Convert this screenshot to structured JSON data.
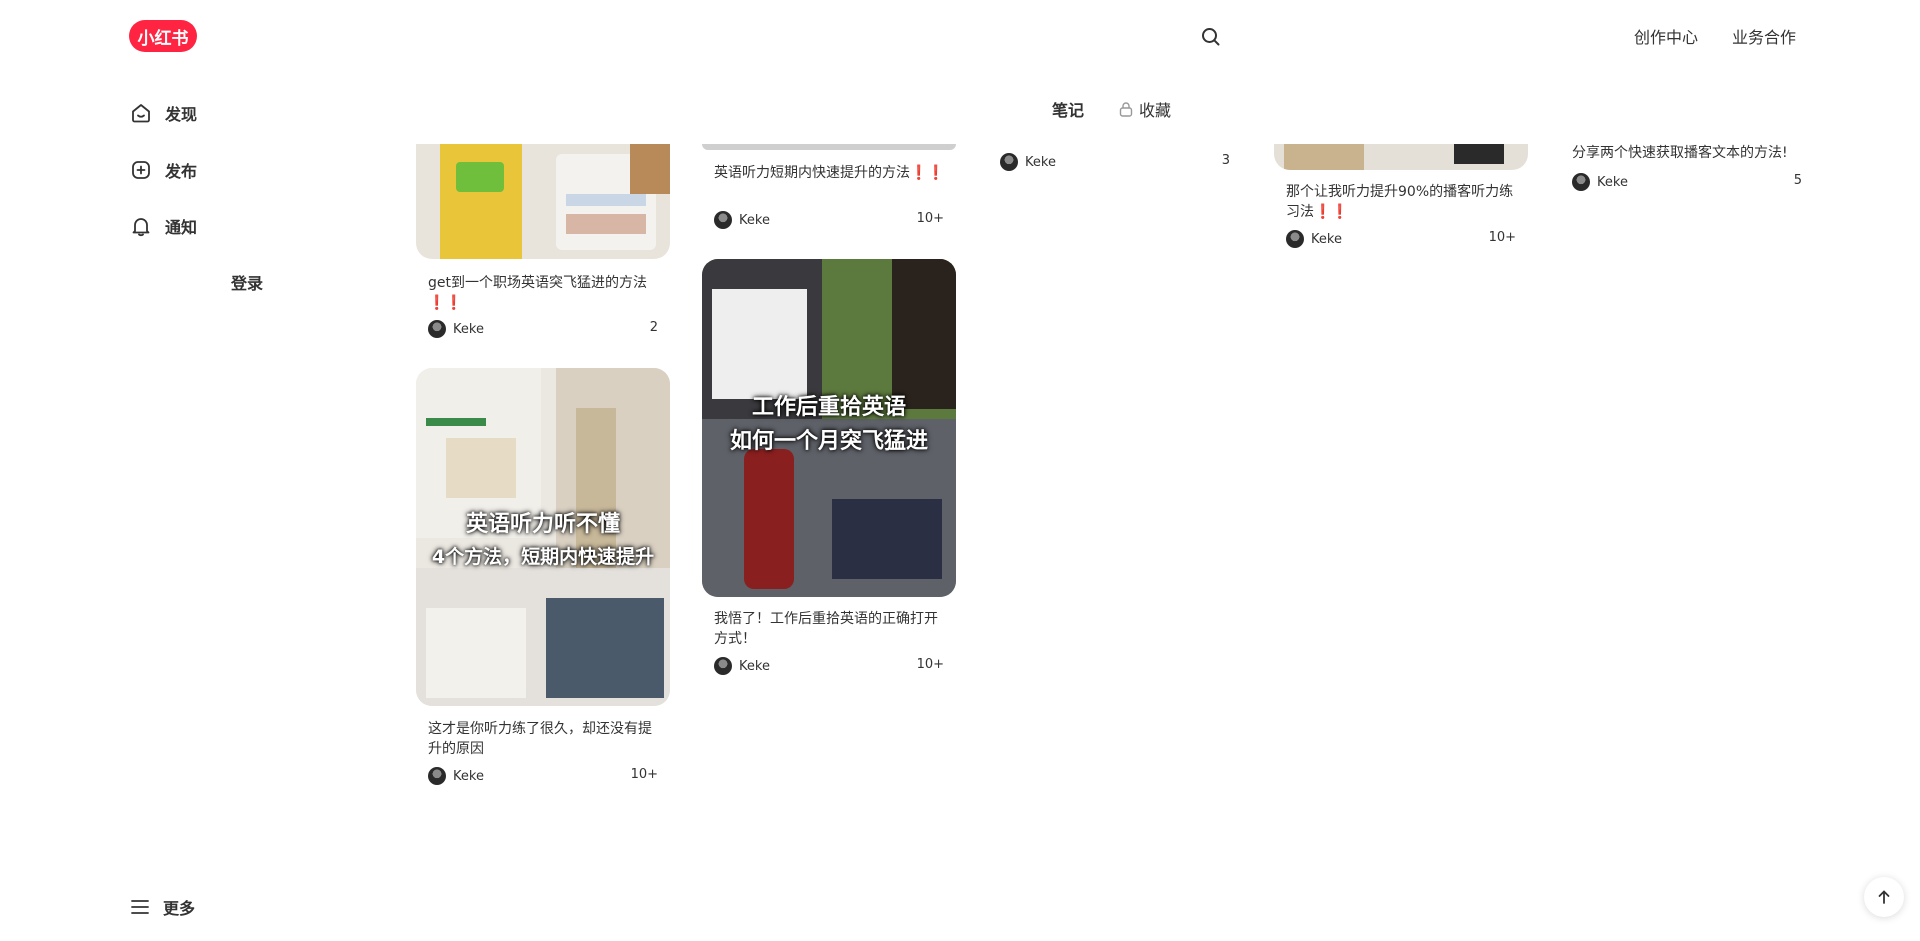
{
  "header": {
    "logo_text": "小红书",
    "links": [
      "创作中心",
      "业务合作"
    ]
  },
  "sidebar": {
    "items": [
      {
        "label": "发现",
        "icon": "home-icon"
      },
      {
        "label": "发布",
        "icon": "plus-icon"
      },
      {
        "label": "通知",
        "icon": "bell-icon"
      }
    ],
    "login": "登录",
    "more": "更多"
  },
  "tabs": {
    "notes": "笔记",
    "collect": "收藏"
  },
  "colors": {
    "brand": "#ff2442",
    "exclaim": "#e02020"
  },
  "notes": [
    {
      "title": "get到一个职场英语突飞猛进的方法",
      "suffix": "❗️❗️",
      "author": "Keke",
      "likes": "2"
    },
    {
      "title": "这才是你听力练了很久，却还没有提升的原因",
      "author": "Keke",
      "likes": "10+",
      "overlay": [
        "英语听力听不懂",
        "4个方法，短期内快速提升"
      ]
    },
    {
      "title": "英语听力短期内快速提升的方法",
      "suffix": "❗️❗️",
      "author": "Keke",
      "likes": "10+"
    },
    {
      "title": "我悟了！工作后重拾英语的正确打开方式！",
      "author": "Keke",
      "likes": "10+",
      "overlay": [
        "工作后重拾英语",
        "如何一个月突飞猛进"
      ]
    },
    {
      "author": "Keke",
      "likes": "3"
    },
    {
      "title": "那个让我听力提升90%的播客听力练习法",
      "suffix": "❗️❗️",
      "author": "Keke",
      "likes": "10+"
    },
    {
      "title": "分享两个快速获取播客文本的方法!",
      "author": "Keke",
      "likes": "5"
    }
  ]
}
